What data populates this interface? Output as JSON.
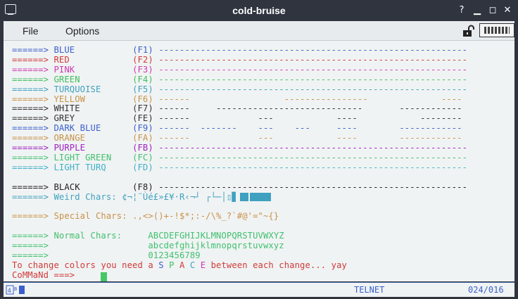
{
  "window": {
    "title": "cold-bruise"
  },
  "menu": {
    "file": "File",
    "options": "Options"
  },
  "colors": {
    "blue": "#3a5fcd",
    "red": "#d13a3a",
    "pink": "#d03ab0",
    "green": "#3fbf5f",
    "turquoise": "#3fa0c0",
    "yellow": "#c8924a",
    "white": "#333333",
    "grey": "#333333",
    "darkblue": "#3a5fcd",
    "orange": "#c8924a",
    "purple": "#a020c0",
    "lightgreen": "#40c070",
    "lightturq": "#3fb0c8",
    "black": "#222222"
  },
  "terminal": {
    "lines": [
      {
        "arrow": "======>",
        "label": "BLUE",
        "key": "(F1)",
        "bar": "-----------------------------------------------------------",
        "color": "blue"
      },
      {
        "arrow": "======>",
        "label": "RED",
        "key": "(F2)",
        "bar": "-----------------------------------------------------------",
        "color": "red"
      },
      {
        "arrow": "======>",
        "label": "PINK",
        "key": "(F3)",
        "bar": "-----------------------------------------------------------",
        "color": "pink"
      },
      {
        "arrow": "======>",
        "label": "GREEN",
        "key": "(F4)",
        "bar": "-----------------------------------------------------------",
        "color": "green"
      },
      {
        "arrow": "======>",
        "label": "TURQUOISE",
        "key": "(F5)",
        "bar": "-----------------------------------------------------------",
        "color": "turquoise"
      },
      {
        "arrow": "======>",
        "label": "YELLOW",
        "key": "(F6)",
        "bar": "------                  ----------------              ----",
        "color": "yellow"
      },
      {
        "arrow": "======>",
        "label": "WHITE",
        "key": "(F7)",
        "bar": "------     ----------------------------       ------------",
        "color": "white"
      },
      {
        "arrow": "======>",
        "label": "GREY",
        "key": "(FE)",
        "bar": "------             ---            ----            --------",
        "color": "grey"
      },
      {
        "arrow": "======>",
        "label": "DARK BLUE",
        "key": "(F9)",
        "bar": "------  -------    ---    ---     ----        ------------",
        "color": "darkblue"
      },
      {
        "arrow": "======>",
        "label": "ORANGE",
        "key": "(FA)",
        "bar": "------             ---            ----        ------------",
        "color": "orange"
      },
      {
        "arrow": "======>",
        "label": "PURPLE",
        "key": "(FB)",
        "bar": "-----------------------------------------------------------",
        "color": "purple"
      },
      {
        "arrow": "======>",
        "label": "LIGHT GREEN",
        "key": "(FC)",
        "bar": "-----------------------------------------------------------",
        "color": "lightgreen"
      },
      {
        "arrow": "======>",
        "label": "LIGHT TURQ",
        "key": "(FD)",
        "bar": "-----------------------------------------------------------",
        "color": "lightturq"
      }
    ],
    "black_line": {
      "arrow": "======>",
      "label": "BLACK",
      "key": "(F8)",
      "bar": "-----------------------------------------------------------"
    },
    "weird": {
      "arrow": "======>",
      "label": "Weird Chars:",
      "chars": "¢¬¦¨Ùé£»£¥·R‹¬┘ ┌└─│▯▊"
    },
    "special": {
      "arrow": "======>",
      "label": "Special Chars:",
      "chars": ".,<>()+-!$*;:-/\\%_?`#@'=\"~{}"
    },
    "normal": {
      "arrow": "======>",
      "label": "Normal Chars:",
      "upper": "ABCDEFGHIJKLMNOPQRSTUVWXYZ",
      "lower": "abcdefghijklmnopqrstuvwxyz",
      "digits": "0123456789"
    },
    "change_prefix": "To change colors you need a ",
    "space_letters": [
      "S",
      "P",
      "A",
      "C",
      "E"
    ],
    "change_suffix": " between each change... yay",
    "command_prompt": "CoMMaNd ===>"
  },
  "status": {
    "mode": "TELNET",
    "position": "024/016"
  }
}
